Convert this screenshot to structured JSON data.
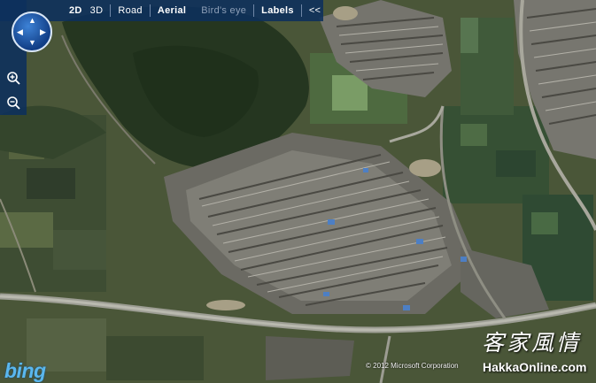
{
  "toolbar": {
    "items": [
      {
        "label": "2D"
      },
      {
        "label": "3D"
      },
      {
        "label": "Road"
      },
      {
        "label": "Aerial"
      },
      {
        "label": "Bird's eye"
      },
      {
        "label": "Labels"
      },
      {
        "label": "<<"
      }
    ]
  },
  "navigation": {
    "pan_icon": "compass-pan-icon",
    "zoom_in_icon": "zoom-in-icon",
    "zoom_out_icon": "zoom-out-icon"
  },
  "footer": {
    "logo": "bing",
    "copyright": "© 2012 Microsoft Corporation"
  },
  "watermark": {
    "chinese": "客家風情",
    "url": "HakkaOnline.com"
  },
  "colors": {
    "toolbar": "#0c305c",
    "logo": "#5ab7ee"
  }
}
